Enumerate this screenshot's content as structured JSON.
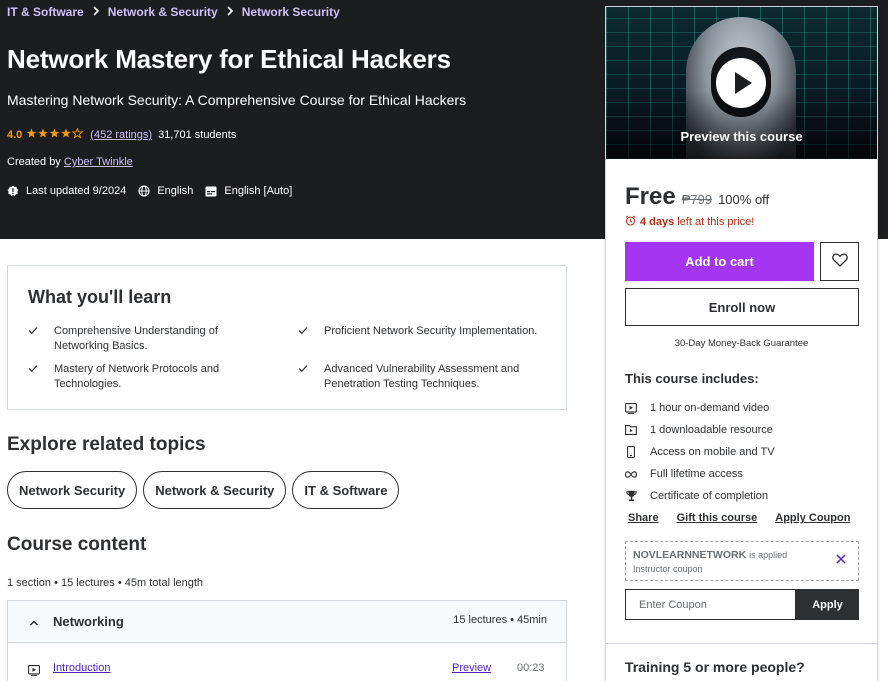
{
  "breadcrumb": [
    "IT & Software",
    "Network & Security",
    "Network Security"
  ],
  "hero": {
    "title": "Network Mastery for Ethical Hackers",
    "subtitle": "Mastering Network Security: A Comprehensive Course for Ethical Hackers",
    "rating": "4.0",
    "stars": 4,
    "stars_max": 5,
    "ratings_count": "(452 ratings)",
    "students": "31,701 students",
    "created_by_label": "Created by",
    "instructor": "Cyber Twinkle",
    "last_updated": "Last updated 9/2024",
    "language": "English",
    "captions": "English [Auto]"
  },
  "sidebar": {
    "preview_label": "Preview this course",
    "price": "Free",
    "original_price": "₱799",
    "discount": "100% off",
    "timer_bold": "4 days",
    "timer_text": "left at this price!",
    "add_to_cart": "Add to cart",
    "enroll": "Enroll now",
    "guarantee": "30-Day Money-Back Guarantee",
    "includes_title": "This course includes:",
    "includes": [
      {
        "icon": "video-icon",
        "label": "1 hour on-demand video"
      },
      {
        "icon": "file-icon",
        "label": "1 downloadable resource"
      },
      {
        "icon": "mobile-icon",
        "label": "Access on mobile and TV"
      },
      {
        "icon": "infinity-icon",
        "label": "Full lifetime access"
      },
      {
        "icon": "trophy-icon",
        "label": "Certificate of completion"
      }
    ],
    "links": [
      "Share",
      "Gift this course",
      "Apply Coupon"
    ],
    "coupon_code": "NOVLEARNNETWORK",
    "coupon_applied": "is applied",
    "coupon_type": "Instructor coupon",
    "coupon_placeholder": "Enter Coupon",
    "apply": "Apply",
    "training": "Training 5 or more people?"
  },
  "learn": {
    "title": "What you'll learn",
    "items": [
      "Comprehensive Understanding of Networking Basics.",
      "Proficient Network Security Implementation.",
      "Mastery of Network Protocols and Technologies.",
      "Advanced Vulnerability Assessment and Penetration Testing Techniques."
    ]
  },
  "related": {
    "title": "Explore related topics",
    "topics": [
      "Network Security",
      "Network & Security",
      "IT & Software"
    ]
  },
  "content": {
    "title": "Course content",
    "summary": "1 section • 15 lectures • 45m total length",
    "sections": [
      {
        "title": "Networking",
        "meta": "15 lectures • 45min",
        "lectures": [
          {
            "title": "Introduction",
            "preview": "Preview",
            "duration": "00:23"
          }
        ]
      }
    ]
  },
  "colors": {
    "hero_bg": "#1c1d1f",
    "accent": "#a435f0",
    "link_light": "#cec0fc",
    "star": "#f69c08",
    "timer": "#b32d0f",
    "link": "#5022c3"
  }
}
